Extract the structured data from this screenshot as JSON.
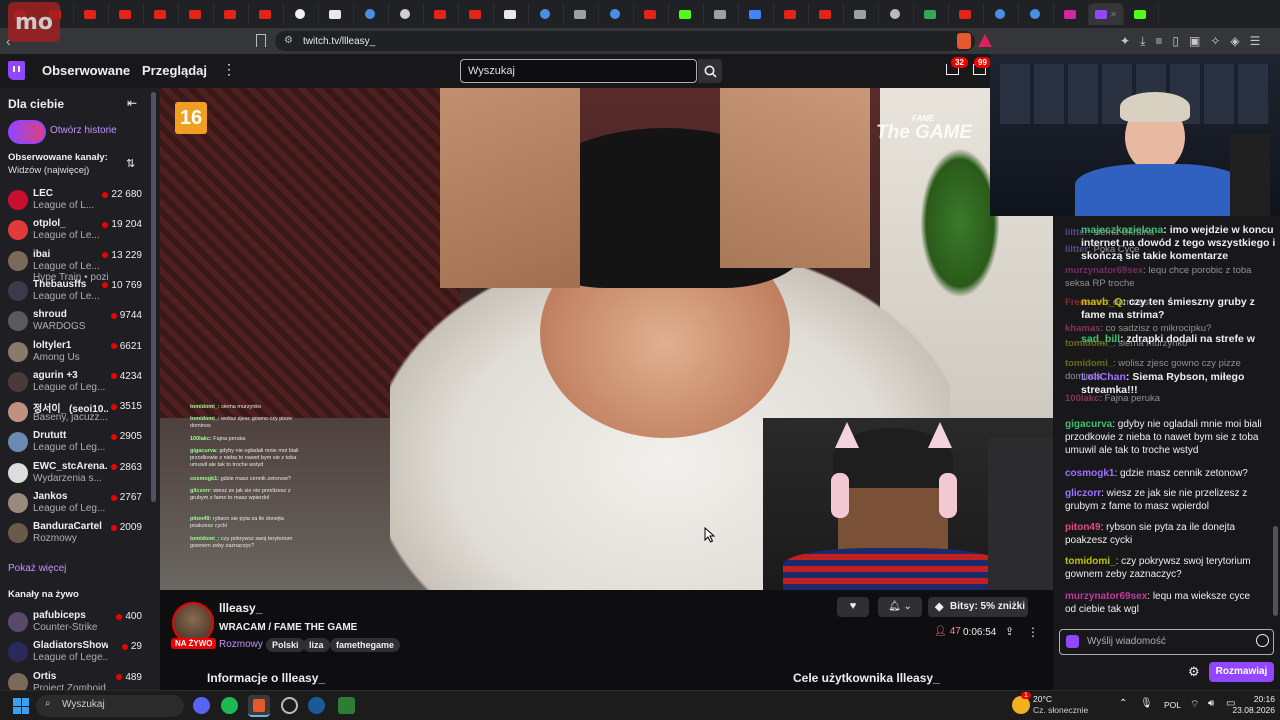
{
  "browser": {
    "url": "twitch.tv/llleasy_",
    "tab_count_icons": [
      "youtube",
      "youtube",
      "youtube",
      "youtube",
      "youtube",
      "youtube",
      "youtube",
      "youtube",
      "notion",
      "x",
      "chrome",
      "github",
      "youtube",
      "youtube",
      "x",
      "chrome",
      "tab",
      "chrome",
      "youtube",
      "kick",
      "tab",
      "docs",
      "youtube",
      "youtube",
      "tab",
      "shield",
      "maps",
      "youtube",
      "chrome",
      "chrome",
      "instagram",
      "twitch",
      "kick"
    ]
  },
  "topnav": {
    "following": "Obserwowane",
    "browse": "Przeglądaj",
    "search_placeholder": "Wyszukaj",
    "notif_count": "32",
    "inbox_count": "99"
  },
  "sidebar": {
    "for_you": "Dla ciebie",
    "open_stories": "Otwórz historie",
    "followed_title": "Obserwowane kanały:",
    "followed_sort": "Widzów (najwięcej)",
    "followed": [
      {
        "name": "LEC",
        "game": "League of L...",
        "viewers": "22 680",
        "color": "#c8102e"
      },
      {
        "name": "otplol_",
        "game": "League of Le...",
        "viewers": "19 204",
        "color": "#e03a3a"
      },
      {
        "name": "ibai",
        "game": "League of Le...",
        "viewers": "13 229",
        "color": "#7a6a5a",
        "extra": "Hype Train • pozio..."
      },
      {
        "name": "Thebausffs",
        "game": "League of Le...",
        "viewers": "10 769",
        "color": "#3a3a4a"
      },
      {
        "name": "shroud",
        "game": "WARDOGS",
        "viewers": "9744",
        "color": "#5a5a5a"
      },
      {
        "name": "loltyler1",
        "game": "Among Us",
        "viewers": "6621",
        "color": "#8a7a6a"
      },
      {
        "name": "agurin +3",
        "game": "League of Leg...",
        "viewers": "4234",
        "color": "#4a3a3a"
      },
      {
        "name": "정서이_ (seoi10...",
        "game": "Baseny, jacuzz...",
        "viewers": "3515",
        "color": "#c09080"
      },
      {
        "name": "Drututt",
        "game": "League of Leg...",
        "viewers": "2905",
        "color": "#6a8ab0"
      },
      {
        "name": "EWC_stcArena...",
        "game": "Wydarzenia s...",
        "viewers": "2863",
        "color": "#dddddd"
      },
      {
        "name": "Jankos",
        "game": "League of Leg...",
        "viewers": "2767",
        "color": "#9a8a7a"
      },
      {
        "name": "BanduraCartel",
        "game": "Rozmowy",
        "viewers": "2009",
        "color": "#6a5a4a"
      }
    ],
    "show_more": "Pokaż więcej",
    "live_title": "Kanały na żywo",
    "live": [
      {
        "name": "pafubiceps",
        "game": "Counter-Strike",
        "viewers": "400",
        "color": "#5a4a6a"
      },
      {
        "name": "GladiatorsShow...",
        "game": "League of Lege...",
        "viewers": "29",
        "color": "#2a2a5a"
      },
      {
        "name": "Ortis",
        "game": "Project Zomboid",
        "viewers": "489",
        "color": "#7a6a5a"
      }
    ]
  },
  "video": {
    "age_rating": "16",
    "brand_small": "FAME",
    "brand_big": "The GAME",
    "overlay_chat": [
      {
        "user": "tomidomi_",
        "text": "siema murzynko"
      },
      {
        "user": "tomidomi_",
        "text": "wolisz zjesc gowno czy pizze dominos"
      },
      {
        "user": "100lakc",
        "text": "Fajna peruka"
      },
      {
        "user": "gigacurva",
        "text": "gdyby nie ogladali mnie moi biali przodkowie z nieba to nawet bym sie z toba umuwil ale tak to troche wstyd"
      },
      {
        "user": "cosmogk1",
        "text": "gdzie masz cennik zetonow?"
      },
      {
        "user": "gliczorr",
        "text": "wiesz ze jak sie nie przelizesz z grubym z fame to masz wpierdol"
      },
      {
        "user": "piton49",
        "text": "rybson sie pyta za ile donejta poakzesz cycki"
      },
      {
        "user": "tomidomi_",
        "text": "czy pokrywsz swoj terytorium gownem zeby zaznaczyc?"
      }
    ]
  },
  "chat": {
    "faded": [
      {
        "user": "liltter",
        "text": "siema Ukraina",
        "color": "#8a6fd0"
      },
      {
        "user": "liltter",
        "text": "Poka Cyce",
        "color": "#8a6fd0"
      },
      {
        "user": "murzynator69sex",
        "text": "lequ chce porobic z toba seksa RP troche",
        "color": "#c03aa0"
      },
      {
        "user": "Fredaoos",
        "text": "dominos",
        "color": "#e04040"
      },
      {
        "user": "khamas",
        "text": "co sadzisz o mikrocipku?",
        "color": "#e04a80"
      },
      {
        "user": "tomidomi_",
        "text": "siema murzynko",
        "color": "#b0b000"
      },
      {
        "user": "tomidomi_",
        "text": "wolisz zjesc gowno czy pizze dominos",
        "color": "#b0b000"
      },
      {
        "user": "100lakc",
        "text": "Fajna peruka",
        "color": "#e04a80"
      }
    ],
    "highlights": [
      {
        "user": "majeczkazielona",
        "text": "imo wejdzie w koncu internet na dowód z tego wszystkiego i skończą sie takie komentarze",
        "color": "#40c070"
      },
      {
        "user": "mavb_Q",
        "text": "czy ten śmieszny gruby z fame ma strima?",
        "color": "#c0c000"
      },
      {
        "user": "sad_bill",
        "text": "zdrapki dodali na strefe w",
        "color": "#40c070"
      },
      {
        "user": "LoliChan",
        "text": "Siema Rybson, miłego streamka!!!",
        "color": "#a070ff"
      }
    ],
    "messages": [
      {
        "user": "gigacurva",
        "text": "gdyby nie ogladali mnie moi biali przodkowie z nieba to nawet bym sie z toba umuwil ale tak to troche wstyd",
        "color": "#40c070"
      },
      {
        "user": "cosmogk1",
        "text": "gdzie masz cennik zetonow?",
        "color": "#a070ff"
      },
      {
        "user": "gliczorr",
        "text": "wiesz ze jak sie nie przelizesz z grubym z fame to masz wpierdol",
        "color": "#a070ff"
      },
      {
        "user": "piton49",
        "text": "rybson sie pyta za ile donejta poakzesz cycki",
        "color": "#e04a80"
      },
      {
        "user": "tomidomi_",
        "text": "czy pokrywsz swoj terytorium gownem zeby zaznaczyc?",
        "color": "#c0c000"
      },
      {
        "user": "murzynator69sex",
        "text": "lequ ma wieksze cyce od ciebie tak wgl",
        "color": "#c03aa0"
      }
    ],
    "input_placeholder": "Wyślij wiadomość",
    "chat_button": "Rozmawiaj"
  },
  "stream": {
    "channel": "llleasy_",
    "title": "WRACAM / FAME THE GAME",
    "live": "NA ŻYWO",
    "category": "Rozmowy",
    "tags": [
      "Polski",
      "liza",
      "famethegame"
    ],
    "bits_label": "Bitsy: 5% zniżki",
    "viewers": "47",
    "uptime": "0:06:54",
    "about": "Informacje o llleasy_",
    "goals": "Cele użytkownika llleasy_"
  },
  "taskbar": {
    "search": "Wyszukaj",
    "weather_temp": "20°C",
    "weather_desc": "Cz. słonecznie",
    "weather_badge": "1",
    "lang": "POL",
    "time": "20:16",
    "date": "23.08.2026"
  }
}
